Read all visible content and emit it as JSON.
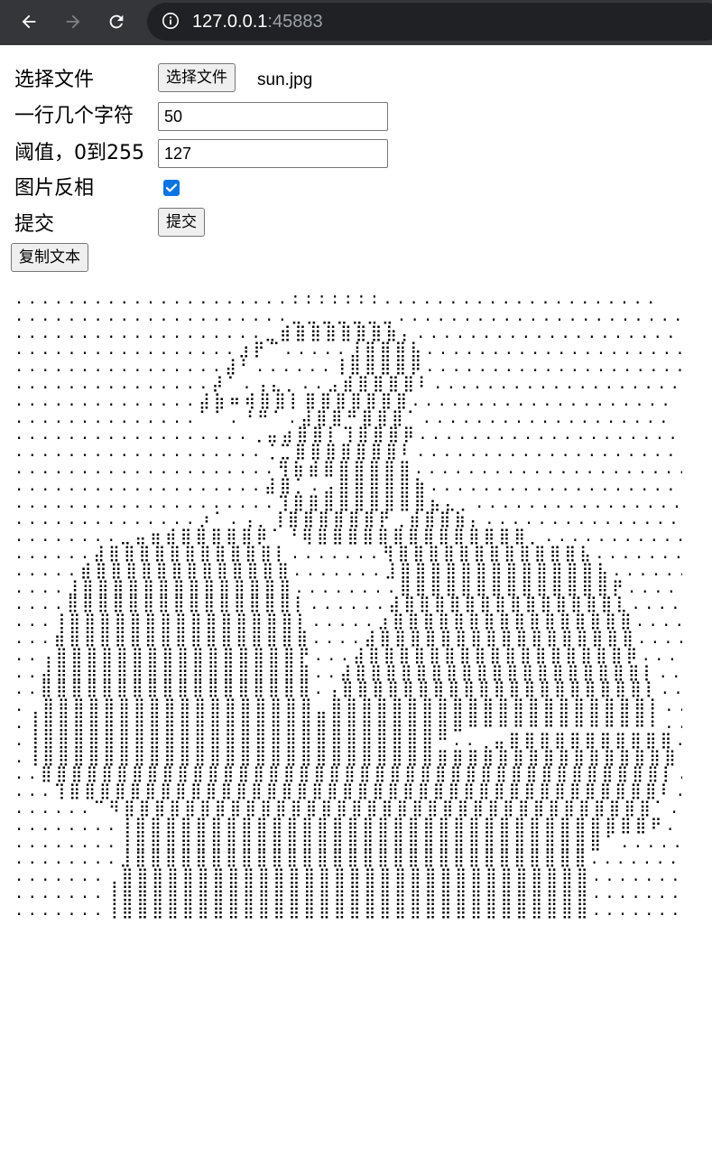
{
  "browser": {
    "url_host": "127.0.0.1",
    "url_port": ":45883",
    "back_icon": "arrow-left-icon",
    "forward_icon": "arrow-right-icon",
    "reload_icon": "reload-icon",
    "info_icon": "info-icon"
  },
  "form": {
    "file_label": "选择文件",
    "file_button": "选择文件",
    "file_name": "sun.jpg",
    "chars_label": "一行几个字符",
    "chars_value": "50",
    "threshold_label": "阈值，0到255",
    "threshold_value": "127",
    "invert_label": "图片反相",
    "invert_checked": true,
    "submit_label": "提交",
    "submit_button": "提交",
    "copy_button": "复制文本"
  },
  "colors": {
    "chrome_bg": "#35363a",
    "omnibox_bg": "#202124",
    "checkbox_accent": "#0b74e5"
  },
  "ascii_lines": [
    ".....................:::::::.....................",
    ".....................⣀⣀⣀⣀⣀⣀⣀......................",
    "...................⣀⣾⣿⣿⣿⣿⣿⣿⣷⡄.....................",
    ".................⣰⡟⠉.....⣸⣿⣿⣿⣧....................",
    "................⣼⠃......⢸⣿⣿⣿⣿⡿....................",
    "...............⡼⠁.⢠⣄⡀..⣠⣾⣿⣿⣿⣿⠇...................",
    "..............⣼⣷⠶⢾⣿⣿⡇⣿⣿⣿⣿⣿⣿⣿....................",
    "..............⠁⠁.⠘⠛⠁.⣼⣿⣿⠛⣿⣿⣿⠁...................",
    "..................⢀⣤⣴⣿⣿⡇⢹⣿⣿⣿⡿....................",
    "...................⢈⣉⣿⣿⣿⣿⣿⣿⣿⠇....................",
    "....................⢻⣷⣾⣿⣿⣿⣿⣿⣿.....................",
    "...................⣼⣿⡁.⣠⣿⣿⣿⣿⣿⣷....................",
    "....................⢹⣿⣿⣿⣿⣿⣿⣿⣿⣿⣦⣄⡀..................",
    "..............⡰⠁.⢠⡀⢸⣿⣿⣿⣿⣿⣿⡟⢀⣾⣿⣿⣷⡄..................",
    "........⣀⣤⣶⣾⣿⣿⣿⣿⣿⡿⠁⠘⢿⣿⣿⣿⣿⣿⣿⣿⣿⣿⣿⣿⣿⣿⣿⡀...............",
    "......⣼⣿⣿⣿⣿⣿⣿⣿⣿⣿⣿⣿⡇.......⢻⣿⣿⣿⣿⣿⣿⣿⣿⣿⣿⣿⣿⣧.............",
    ".....⣾⣿⣿⣿⣿⣿⣿⣿⣿⣿⣿⣿⣿⣿.......⣸⣿⣿⣿⣿⣿⣿⣿⣿⣿⣿⣿⣿⣿⣧............",
    "....⣸⣿⣿⣿⣿⣿⣿⣿⣿⣿⣿⣿⣿⣿⣿........⣿⣿⣿⣿⣿⣿⣿⣿⣿⣿⣿⣿⣿⣿⡟...........",
    "....⣿⣿⣿⣿⣿⣿⣿⣿⣿⣿⣿⣿⣿⣿⣿⡇......⣼⣿⣿⣿⣿⣿⣿⣿⣿⣿⣿⣿⣿⣿⣿⣇..........",
    "...⢸⣿⣿⣿⣿⣿⣿⣿⣿⣿⣿⣿⣿⣿⣿⣿⡇.....⣰⣿⣿⣿⣿⣿⣿⣿⣿⣿⣿⣿⣿⣿⣿⣿⣿..........",
    "...⣾⣿⣿⣿⣿⣿⣿⣿⣿⣿⣿⣿⣿⣿⣿⣿⣿....⣼⣿⣿⣿⣿⣿⣿⣿⣿⣿⣿⣿⣿⣿⣿⣿⣿⣿..........",
    "..⢠⣿⣿⣿⣿⣿⣿⣿⣿⣿⣿⣿⣿⣿⣿⣿⣿⡟...⣼⣿⣿⣿⣿⣿⣿⣿⣿⣿⣿⣿⣿⣿⣿⣿⣿⣿⡿..........",
    "..⣼⣿⣿⣿⣿⣿⣿⣿⣿⣿⣿⣿⣿⣿⣿⣿⣿⣿..⣼⣿⣿⣿⣿⣿⣿⣿⣿⣿⣿⣿⣿⣿⣿⣿⣿⣿⣿⣿⡇.........",
    "..⣿⣿⣿⣿⣿⣿⣿⣿⣿⣿⣿⣿⣿⣿⣿⣿⣿⣿.⢠⣿⣿⣿⣿⣿⣿⣿⣿⣿⣿⣿⣿⣿⣿⣿⣿⣿⣿⣿⣿⡇.........",
    ".⢀⣿⣿⣿⣿⣿⣿⣿⣿⣿⣿⣿⣿⣿⣿⣿⣿⣿⣿⣀⣿⣿⣿⣿⣿⣿⣿⣿⣿⣿⣿⣿⣿⣿⣿⣿⣿⣿⣿⣿⣿⡇.........",
    ".⢸⣿⣿⣿⣿⣿⣿⣿⣿⣿⣿⣿⣿⣿⣿⣿⣿⣿⣿⣿⣿⣿⣿⣿⣿⣿⣿⣿⣿⠿⠿⠿⠿⠿⠿⠿⠿⠿⠿⠿⠿⠇.........",
    ".⢸⣿⣿⣿⣿⣿⣿⣿⣿⣿⣿⣿⣿⣿⣿⣿⣿⣿⣿⣿⣿⣿⣿⣿⣿⣿⣿⠛..⢀⣤⣿⣿⣿⣿⣿⣿⣿⣿⣿⣿⣿..........",
    ".⢸⣿⣿⣿⣿⣿⣿⣿⣿⣿⣿⣿⣿⣿⣿⣿⣿⣿⣿⣿⣿⣿⣿⣿⣿⣿⣿⣿⣿⣿⣿⣿⣿⣿⣿⣿⣿⣿⣿⣿⣿⣿⣿..........",
    "..⣿⣿⣿⣿⣿⣿⣿⣿⣿⣿⣿⣿⣿⣿⣿⣿⣿⣿⣿⣿⣿⣿⣿⣿⣿⣿⣿⣿⣿⣿⣿⣿⣿⣿⣿⣿⣿⣿⣿⣿⣿⡇..........",
    "...⢹⣿⣿⣿⣿⣿⣿⣿⣿⣿⣿⣿⣿⣿⣿⣿⣿⣿⣿⣿⣿⣿⣿⣿⣿⣿⣿⣿⣿⣿⣿⣿⣿⣿⣿⣿⣿⣿⣿⣿⠇..........",
    "......⠉⠻⣿⣿⣿⣿⣿⣿⣿⣿⣿⣿⣿⣿⣿⣿⣿⣿⣿⣿⣿⣿⣿⣿⣿⣿⣿⣿⣿⣿⣿⣿⣿⣿⣿⣿⣿⠁...........",
    "........⢸⣿⣿⣿⣿⣿⣿⣿⣿⣿⣿⣿⣿⣿⣿⣿⣿⣿⣿⣿⣿⣿⣿⣿⣿⣿⣿⣿⣿⣿⣿⣿⣿⣿⣿⠟............",
    "........⢸⣿⣿⣿⣿⣿⣿⣿⣿⣿⣿⣿⣿⣿⣿⣿⣿⣿⣿⣿⣿⣿⣿⣿⣿⣿⣿⣿⣿⣿⣿⣿⠁..............",
    "........⣸⣿⣿⣿⣿⣿⣿⣿⣿⣿⣿⣿⣿⣿⣿⣿⣿⣿⣿⣿⣿⣿⣿⣿⣿⣿⣿⣿⣿⣿⣿...............",
    ".......⢀⣿⣿⣿⣿⣿⣿⣿⣿⣿⣿⣿⣿⣿⣿⣿⣿⣿⣿⣿⣿⣿⣿⣿⣿⣿⣿⣿⣿⣿⣿⣿...............",
    ".......⢸⣿⣿⣿⣿⣿⣿⣿⣿⣿⣿⣿⣿⣿⣿⣿⣿⣿⣿⣿⣿⣿⣿⣿⣿⣿⣿⣿⣿⣿⣿⣿...............",
    ".......⢸⣿⣿⣿⣿⣿⣿⣿⣿⣿⣿⣿⣿⣿⣿⣿⣿⣿⣿⣿⣿⣿⣿⣿⣿⣿⣿⣿⣿⣿⣿⣿..............."
  ]
}
